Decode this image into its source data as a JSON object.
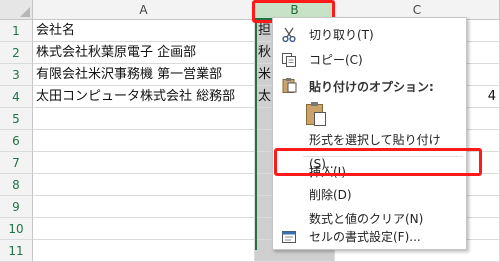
{
  "columns": {
    "a": "A",
    "b": "B",
    "c": "C"
  },
  "rows": [
    "1",
    "2",
    "3",
    "4",
    "5",
    "6",
    "7",
    "8",
    "9",
    "10",
    "11"
  ],
  "cells": {
    "a1": "会社名",
    "a2": "株式会社秋葉原電子 企画部",
    "a3": "有限会社米沢事務機 第一営業部",
    "a4": "太田コンピュータ株式会社 総務部",
    "b1": "担",
    "b2": "秋",
    "b3": "米",
    "b4": "太",
    "c4": "4"
  },
  "context_menu": {
    "cut": "切り取り(T)",
    "copy": "コピー(C)",
    "paste_options_header": "貼り付けのオプション:",
    "paste_special": "形式を選択して貼り付け(S)...",
    "insert": "挿入(I)",
    "delete": "削除(D)",
    "clear_contents": "数式と値のクリア(N)",
    "format_cells": "セルの書式設定(F)..."
  },
  "colors": {
    "excel_green": "#217346",
    "highlight_red": "#ff1a1a",
    "selected_col": "#cfcfcf"
  },
  "icons": [
    "scissors-icon",
    "copy-icon",
    "paste-icon",
    "clipboard-icon",
    "format-cells-icon"
  ]
}
